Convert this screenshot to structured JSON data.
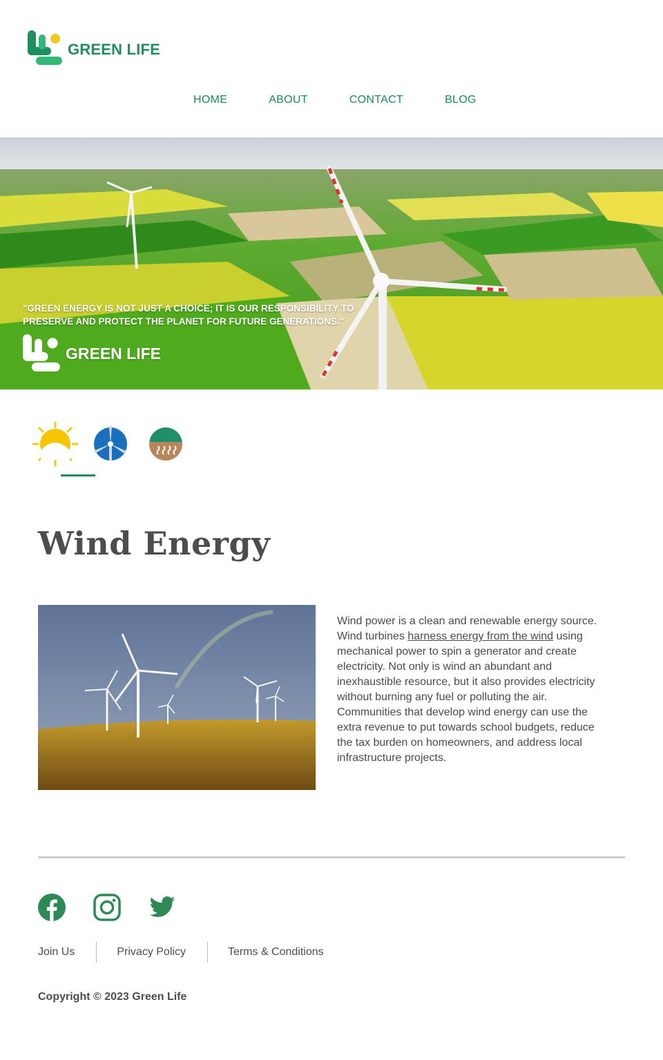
{
  "brand": {
    "name": "GREEN LIFE",
    "primary_color": "#1f8f5f",
    "accent_yellow": "#f2c81a"
  },
  "nav": {
    "items": [
      "HOME",
      "ABOUT",
      "CONTACT",
      "BLOG"
    ]
  },
  "hero": {
    "quote": "\"GREEN ENERGY IS NOT JUST A CHOICE; IT IS OUR RESPONSIBILITY TO PRESERVE AND PROTECT THE PLANET FOR FUTURE GENERATIONS.\"",
    "logo_text": "GREEN LIFE"
  },
  "energy_tabs": [
    {
      "icon": "sun-icon",
      "selected": false
    },
    {
      "icon": "wind-turbine-icon",
      "selected": true
    },
    {
      "icon": "geothermal-icon",
      "selected": false
    }
  ],
  "section": {
    "title": "Wind Energy",
    "text_before_link": "Wind power is a clean and renewable energy source. Wind turbines ",
    "link_text": "harness energy from the wind",
    "text_after_link": " using mechanical power to spin a generator and create electricity. Not only is wind an abundant and inexhaustible resource, but it also provides electricity without burning any fuel or polluting the air. Communities that develop wind energy can use the extra revenue to put towards school budgets, reduce the tax burden on homeowners, and address local infrastructure projects."
  },
  "footer": {
    "social": [
      "facebook-icon",
      "instagram-icon",
      "twitter-icon"
    ],
    "links": [
      "Join Us",
      "Privacy Policy",
      "Terms & Conditions"
    ],
    "copyright": "Copyright © 2023 Green Life"
  }
}
